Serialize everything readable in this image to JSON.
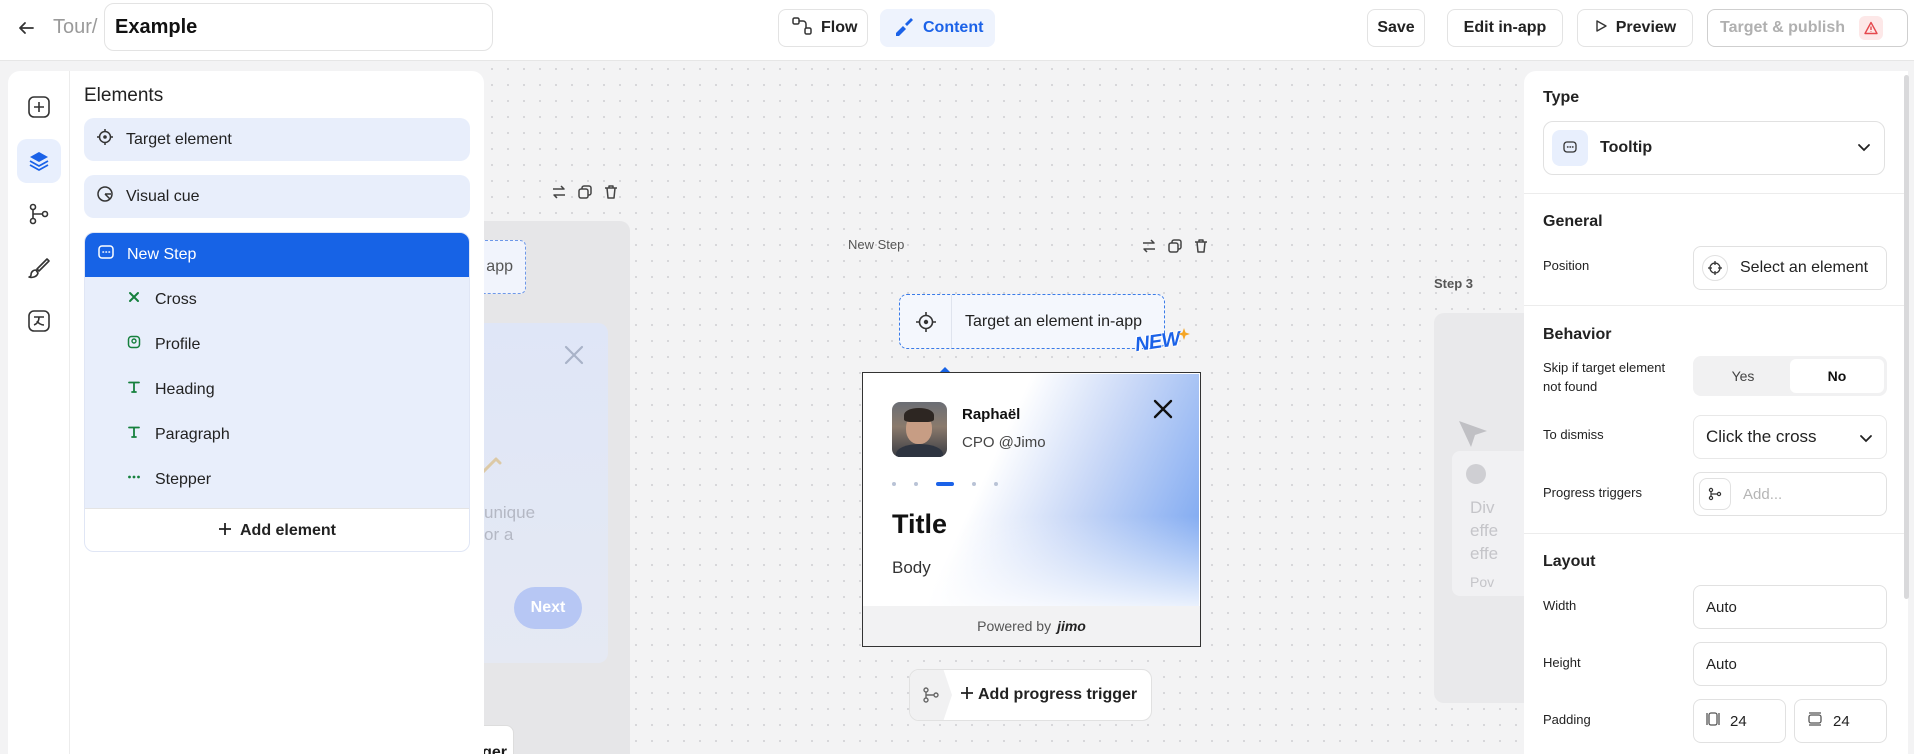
{
  "header": {
    "breadcrumb": "Tour/",
    "title_value": "Example",
    "flow_label": "Flow",
    "content_label": "Content",
    "save_label": "Save",
    "edit_in_app_label": "Edit in-app",
    "preview_label": "Preview",
    "publish_label": "Target & publish"
  },
  "rail": {
    "items": [
      "add-icon",
      "layers-icon",
      "branch-icon",
      "brush-icon",
      "translate-icon"
    ],
    "active": "layers-icon"
  },
  "elements_panel": {
    "title": "Elements",
    "items": [
      {
        "label": "Target element",
        "icon": "target-icon"
      },
      {
        "label": "Visual cue",
        "icon": "visual-cue-icon"
      }
    ],
    "step": {
      "label": "New Step",
      "children": [
        {
          "label": "Cross",
          "icon": "cross-icon"
        },
        {
          "label": "Profile",
          "icon": "profile-icon"
        },
        {
          "label": "Heading",
          "icon": "heading-icon"
        },
        {
          "label": "Paragraph",
          "icon": "paragraph-icon"
        },
        {
          "label": "Stepper",
          "icon": "stepper-icon"
        }
      ]
    },
    "add_element_label": "Add element"
  },
  "canvas": {
    "prev_step": {
      "target_text": "app",
      "body_text_line1": "unique",
      "body_text_line2": "or a",
      "next_label": "Next",
      "trigger_text": "ger"
    },
    "new_step": {
      "label": "New Step",
      "target_label": "Target an element in-app",
      "new_badge": "NEW",
      "tooltip": {
        "author_name": "Raphaël",
        "author_role": "CPO @Jimo",
        "stepper_count": 5,
        "stepper_active": 3,
        "title": "Title",
        "body": "Body",
        "powered_by": "Powered by",
        "brand": "jimo"
      },
      "add_trigger_label": "Add progress trigger"
    },
    "step3": {
      "label": "Step 3",
      "text_line1": "Div",
      "text_line2": "effe",
      "text_line3": "effe",
      "text_line4": "Pov"
    }
  },
  "settings": {
    "type_title": "Type",
    "type_value": "Tooltip",
    "general_title": "General",
    "position_label": "Position",
    "position_value": "Select an element",
    "behavior_title": "Behavior",
    "skip_label_line1": "Skip if target element",
    "skip_label_line2": "not found",
    "skip_yes": "Yes",
    "skip_no": "No",
    "skip_selected": "No",
    "dismiss_label": "To dismiss",
    "dismiss_value": "Click the cross",
    "progress_label": "Progress triggers",
    "progress_placeholder": "Add...",
    "layout_title": "Layout",
    "width_label": "Width",
    "width_value": "Auto",
    "height_label": "Height",
    "height_value": "Auto",
    "padding_label": "Padding",
    "padding_h": "24",
    "padding_v": "24"
  },
  "colors": {
    "accent": "#1763E6",
    "accent_light": "#E8EFFD",
    "warning": "#E5484D"
  }
}
